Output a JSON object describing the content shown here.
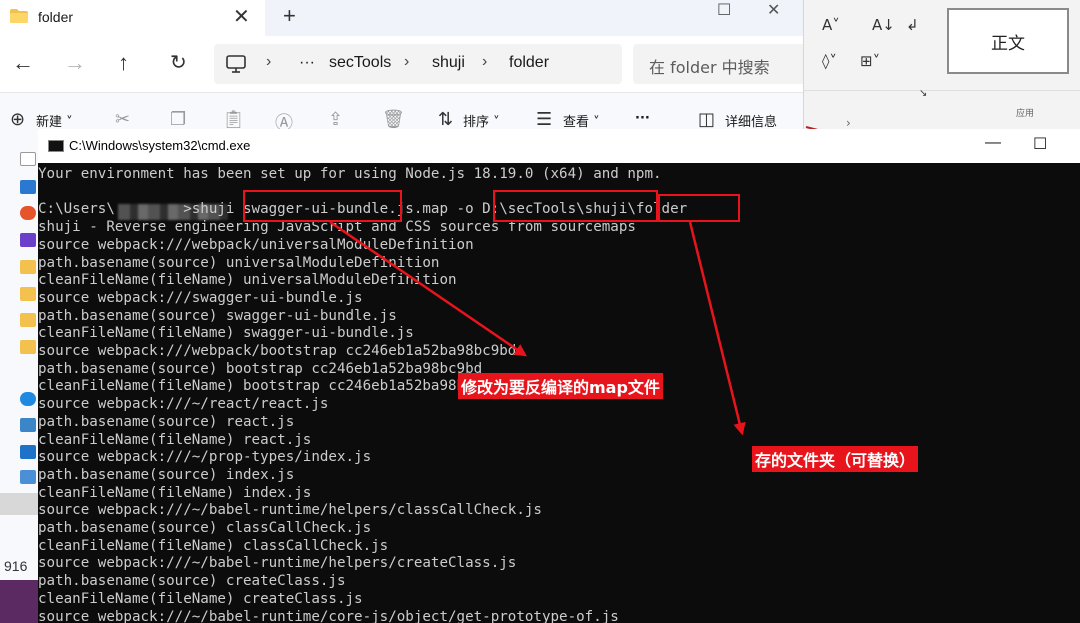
{
  "word": {
    "style_label": "正文",
    "group_label": "应用",
    "ribbon_icons": [
      "font-size-icon",
      "sort-icon",
      "paragraph-mark-icon",
      "fill-icon",
      "borders-icon"
    ]
  },
  "explorer": {
    "tab_title": "folder",
    "breadcrumbs": [
      "secTools",
      "shuji",
      "folder"
    ],
    "search_placeholder": "在 folder 中搜索",
    "commands": {
      "new_label": "新建",
      "sort_label": "排序",
      "view_label": "查看",
      "more_label": "···",
      "details_label": "详细信息"
    },
    "sidebar_number": "916"
  },
  "cmd": {
    "title": "C:\\Windows\\system32\\cmd.exe",
    "lines": [
      "Your environment has been set up for using Node.js 18.19.0 (x64) and npm.",
      "",
      "C:\\Users\\        >shuji swagger-ui-bundle.js.map -o D:\\secTools\\shuji\\folder",
      "shuji - Reverse engineering JavaScript and CSS sources from sourcemaps",
      "source webpack:///webpack/universalModuleDefinition",
      "path.basename(source) universalModuleDefinition",
      "cleanFileName(fileName) universalModuleDefinition",
      "source webpack:///swagger-ui-bundle.js",
      "path.basename(source) swagger-ui-bundle.js",
      "cleanFileName(fileName) swagger-ui-bundle.js",
      "source webpack:///webpack/bootstrap cc246eb1a52ba98bc9bd",
      "path.basename(source) bootstrap cc246eb1a52ba98bc9bd",
      "cleanFileName(fileName) bootstrap cc246eb1a52ba98bc9bd",
      "source webpack:///~/react/react.js",
      "path.basename(source) react.js",
      "cleanFileName(fileName) react.js",
      "source webpack:///~/prop-types/index.js",
      "path.basename(source) index.js",
      "cleanFileName(fileName) index.js",
      "source webpack:///~/babel-runtime/helpers/classCallCheck.js",
      "path.basename(source) classCallCheck.js",
      "cleanFileName(fileName) classCallCheck.js",
      "source webpack:///~/babel-runtime/helpers/createClass.js",
      "path.basename(source) createClass.js",
      "cleanFileName(fileName) createClass.js",
      "source webpack:///~/babel-runtime/core-js/object/get-prototype-of.js"
    ]
  },
  "annotations": {
    "map_note": "修改为要反编译的map文件",
    "folder_note": "存的文件夹（可替换）",
    "color": "#e8141c"
  }
}
